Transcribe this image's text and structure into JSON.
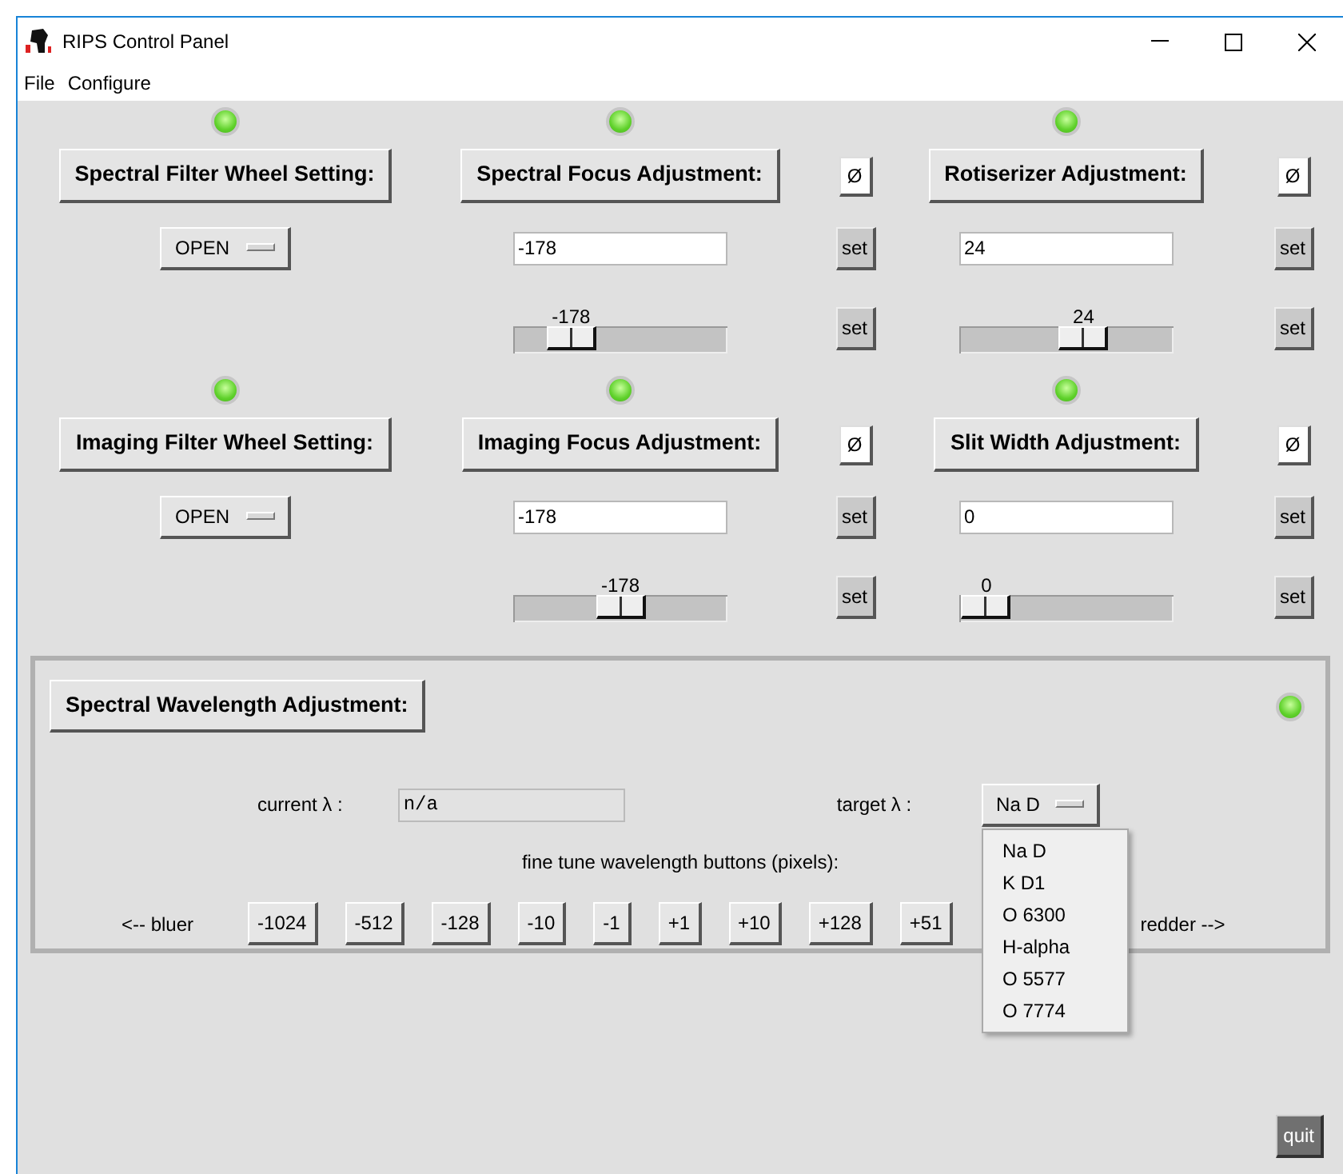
{
  "window": {
    "title": "RIPS Control Panel"
  },
  "menu": [
    "File",
    "Configure"
  ],
  "blocks": [
    {
      "filter": {
        "led_on": true,
        "button": "Spectral Filter Wheel Setting:",
        "value": "OPEN"
      },
      "adjusters": [
        {
          "led_on": true,
          "button": "Spectral Focus Adjustment:",
          "zero": "Ø",
          "entry": "-178",
          "set_entry": "set",
          "reading": "-178",
          "level": 0.27,
          "set_slider": "set"
        },
        {
          "led_on": true,
          "button": "Rotiserizer Adjustment:",
          "zero": "Ø",
          "entry": "24",
          "set_entry": "set",
          "reading": "24",
          "level": 0.58,
          "set_slider": "set"
        }
      ]
    },
    {
      "filter": {
        "led_on": true,
        "button": "Imaging Filter Wheel Setting:",
        "value": "OPEN"
      },
      "adjusters": [
        {
          "led_on": true,
          "button": "Imaging Focus Adjustment:",
          "zero": "Ø",
          "entry": "-178",
          "set_entry": "set",
          "reading": "-178",
          "level": 0.5,
          "set_slider": "set"
        },
        {
          "led_on": true,
          "button": "Slit Width Adjustment:",
          "zero": "Ø",
          "entry": "0",
          "set_entry": "set",
          "reading": "0",
          "set_slider": "set"
        }
      ]
    }
  ],
  "wavelength": {
    "button": "Spectral Wavelength Adjustment:",
    "led_on": true,
    "current_label": "current λ :",
    "current_value": "n/a",
    "target_label": "target λ :",
    "target_value": "Na D",
    "fine_tune_label": "fine tune wavelength buttons (pixels):",
    "bluer": "<-- bluer",
    "steps": [
      "-1024",
      "-512",
      "-128",
      "-10",
      "-1",
      "+1",
      "+10",
      "+128",
      "+51"
    ],
    "redder": "redder -->",
    "menu": {
      "open": true,
      "items": [
        "Na D",
        "K D1",
        "O 6300",
        "H-alpha",
        "O 5577",
        "O 7774"
      ]
    }
  },
  "quit": "quit"
}
